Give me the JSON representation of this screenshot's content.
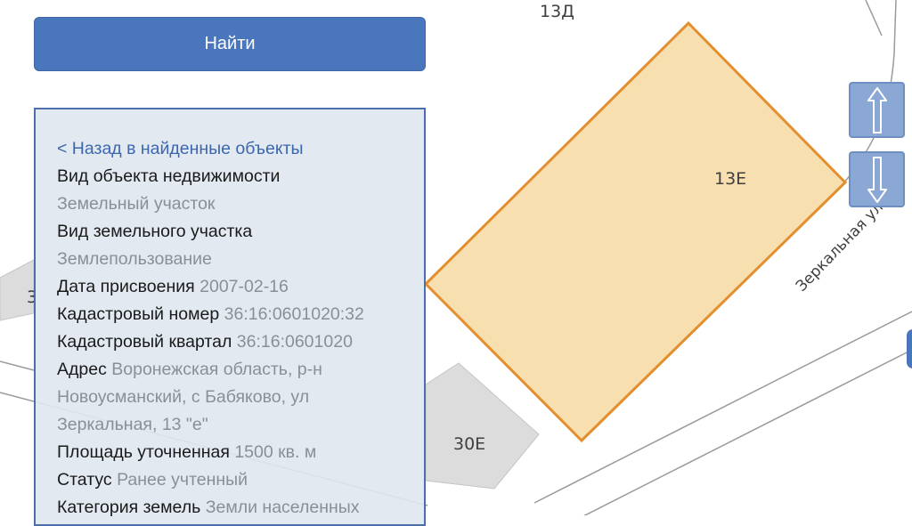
{
  "map": {
    "labels": {
      "top_plot": "13Д",
      "selected_plot": "13Е",
      "lower_plot": "30Е",
      "street": "Зеркальная ул.",
      "left_partial": "3"
    },
    "colors": {
      "selected_fill": "#f7dca6",
      "selected_border": "#e38e2f",
      "building": "#dcdcdc",
      "road_line": "#9a9a9a"
    }
  },
  "search": {
    "button_label": "Найти"
  },
  "panel": {
    "back_link": "< Назад в найденные объекты",
    "property_type_label": "Вид объекта недвижимости",
    "property_type_value": "Земельный участок",
    "land_type_label": "Вид земельного участка",
    "land_type_value": "Землепользование",
    "date_label": "Дата присвоения",
    "date_value": "2007-02-16",
    "cadastral_number_label": "Кадастровый номер",
    "cadastral_number_value": "36:16:0601020:32",
    "cadastral_block_label": "Кадастровый квартал",
    "cadastral_block_value": "36:16:0601020",
    "address_label": "Адрес",
    "address_line1": "Воронежская область, р-н",
    "address_line2": "Новоусманский, с Бабяково, ул",
    "address_line3": "Зеркальная, 13 \"е\"",
    "area_label": "Площадь уточненная",
    "area_value": "1500 кв. м",
    "status_label": "Статус",
    "status_value": "Ранее учтенный",
    "category_label": "Категория земель",
    "category_value": "Земли населенных"
  },
  "controls": {
    "up_icon": "arrow-up-icon",
    "down_icon": "arrow-down-icon"
  }
}
